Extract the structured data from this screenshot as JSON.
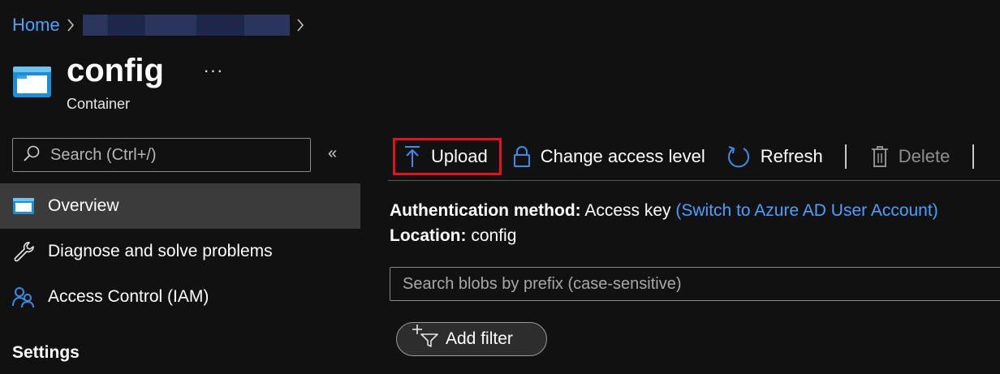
{
  "breadcrumb": {
    "home": "Home"
  },
  "header": {
    "title": "config",
    "more": "···",
    "subtitle": "Container"
  },
  "sidebar": {
    "search_placeholder": "Search (Ctrl+/)",
    "collapse": "«",
    "items": [
      {
        "label": "Overview",
        "icon": "container-icon",
        "active": true
      },
      {
        "label": "Diagnose and solve problems",
        "icon": "wrench-icon"
      },
      {
        "label": "Access Control (IAM)",
        "icon": "people-icon"
      }
    ],
    "section": "Settings"
  },
  "toolbar": {
    "upload": "Upload",
    "change_access": "Change access level",
    "refresh": "Refresh",
    "delete": "Delete"
  },
  "info": {
    "auth_key": "Authentication method:",
    "auth_value": "Access key",
    "auth_link": "(Switch to Azure AD User Account)",
    "location_key": "Location:",
    "location_value": "config"
  },
  "blob_search": {
    "placeholder": "Search blobs by prefix (case-sensitive)"
  },
  "filter": {
    "label": "Add filter"
  },
  "colors": {
    "background": "#111111",
    "link": "#4aa0ff",
    "highlight_border": "#e3131b",
    "active_nav": "#3b3b3b"
  }
}
